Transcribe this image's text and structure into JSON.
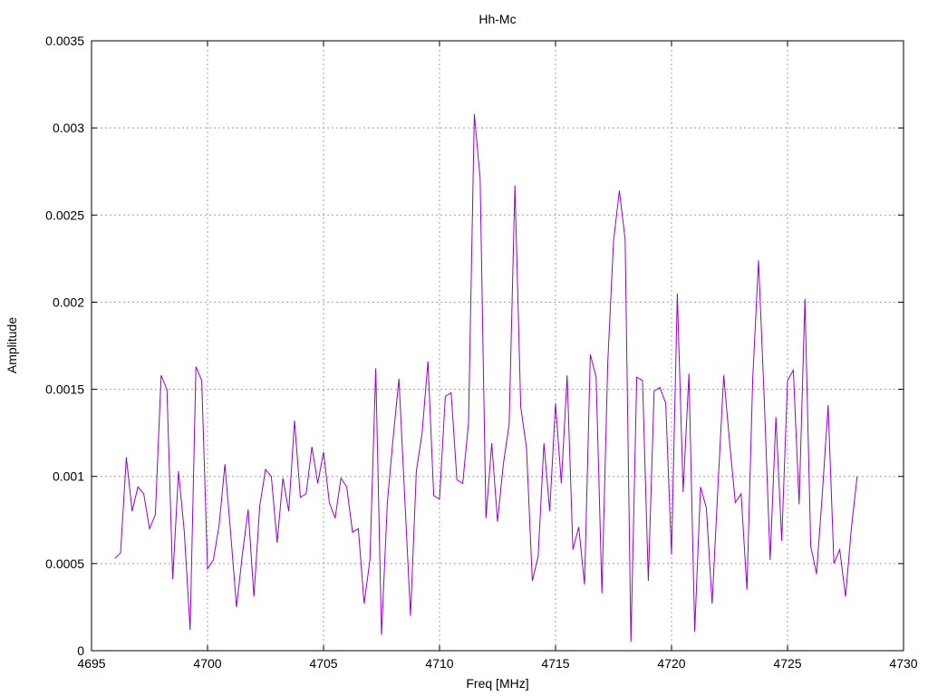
{
  "chart_data": {
    "type": "line",
    "title": "Hh-Mc",
    "xlabel": "Freq [MHz]",
    "ylabel": "Amplitude",
    "xlim": [
      4695,
      4730
    ],
    "ylim": [
      0,
      0.0035
    ],
    "xticks": [
      4695,
      4700,
      4705,
      4710,
      4715,
      4720,
      4725,
      4730
    ],
    "yticks": [
      0,
      0.0005,
      0.001,
      0.0015,
      0.002,
      0.0025,
      0.003,
      0.0035
    ],
    "xtick_labels": [
      "4695",
      "4700",
      "4705",
      "4710",
      "4715",
      "4720",
      "4725",
      "4730"
    ],
    "ytick_labels": [
      "0",
      "0.0005",
      "0.001",
      "0.0015",
      "0.002",
      "0.0025",
      "0.003",
      "0.0035"
    ],
    "grid": true,
    "legend": "none",
    "color": "#9400d3",
    "series": [
      {
        "x": [
          4696.0,
          4696.25,
          4696.5,
          4696.75,
          4697.0,
          4697.25,
          4697.5,
          4697.75,
          4698.0,
          4698.25,
          4698.5,
          4698.75,
          4699.0,
          4699.25,
          4699.5,
          4699.75,
          4700.0,
          4700.25,
          4700.5,
          4700.75,
          4701.0,
          4701.25,
          4701.5,
          4701.75,
          4702.0,
          4702.25,
          4702.5,
          4702.75,
          4703.0,
          4703.25,
          4703.5,
          4703.75,
          4704.0,
          4704.25,
          4704.5,
          4704.75,
          4705.0,
          4705.25,
          4705.5,
          4705.75,
          4706.0,
          4706.25,
          4706.5,
          4706.75,
          4707.0,
          4707.25,
          4707.5,
          4707.75,
          4708.0,
          4708.25,
          4708.5,
          4708.75,
          4709.0,
          4709.25,
          4709.5,
          4709.75,
          4710.0,
          4710.25,
          4710.5,
          4710.75,
          4711.0,
          4711.25,
          4711.5,
          4711.75,
          4712.0,
          4712.25,
          4712.5,
          4712.75,
          4713.0,
          4713.25,
          4713.5,
          4713.75,
          4714.0,
          4714.25,
          4714.5,
          4714.75,
          4715.0,
          4715.25,
          4715.5,
          4715.75,
          4716.0,
          4716.25,
          4716.5,
          4716.75,
          4717.0,
          4717.25,
          4717.5,
          4717.75,
          4718.0,
          4718.25,
          4718.5,
          4718.75,
          4719.0,
          4719.25,
          4719.5,
          4719.75,
          4720.0,
          4720.25,
          4720.5,
          4720.75,
          4721.0,
          4721.25,
          4721.5,
          4721.75,
          4722.0,
          4722.25,
          4722.5,
          4722.75,
          4723.0,
          4723.25,
          4723.5,
          4723.75,
          4724.0,
          4724.25,
          4724.5,
          4724.75,
          4725.0,
          4725.25,
          4725.5,
          4725.75,
          4726.0,
          4726.25,
          4726.5,
          4726.75,
          4727.0,
          4727.25,
          4727.5,
          4727.75,
          4728.0
        ],
        "values": [
          0.00053,
          0.00056,
          0.00111,
          0.0008,
          0.00094,
          0.0009,
          0.0007,
          0.00078,
          0.00158,
          0.0015,
          0.00041,
          0.00103,
          0.00068,
          0.00012,
          0.00163,
          0.00155,
          0.00047,
          0.00052,
          0.00072,
          0.00107,
          0.00067,
          0.00025,
          0.00055,
          0.00081,
          0.00031,
          0.00083,
          0.00104,
          0.001,
          0.00062,
          0.00099,
          0.0008,
          0.00132,
          0.00088,
          0.0009,
          0.00117,
          0.00096,
          0.00114,
          0.00085,
          0.00076,
          0.00099,
          0.00094,
          0.00068,
          0.0007,
          0.00027,
          0.00052,
          0.00162,
          9e-05,
          0.00085,
          0.00122,
          0.00156,
          0.00088,
          0.0002,
          0.00103,
          0.00125,
          0.00166,
          0.00089,
          0.00087,
          0.00146,
          0.00148,
          0.00098,
          0.00096,
          0.00131,
          0.00308,
          0.00271,
          0.00076,
          0.00119,
          0.00074,
          0.00107,
          0.0013,
          0.00267,
          0.0014,
          0.00116,
          0.0004,
          0.00054,
          0.00119,
          0.0008,
          0.00142,
          0.00096,
          0.00158,
          0.00058,
          0.00071,
          0.00038,
          0.0017,
          0.00157,
          0.00033,
          0.00165,
          0.00235,
          0.00264,
          0.00236,
          5e-05,
          0.00157,
          0.00155,
          0.0004,
          0.00149,
          0.00151,
          0.00142,
          0.00055,
          0.00205,
          0.00091,
          0.00159,
          0.00011,
          0.00094,
          0.00082,
          0.00027,
          0.00094,
          0.00158,
          0.0012,
          0.00085,
          0.0009,
          0.00035,
          0.00156,
          0.00224,
          0.00143,
          0.00052,
          0.00134,
          0.00063,
          0.00155,
          0.00161,
          0.00084,
          0.00202,
          0.0006,
          0.00044,
          0.0009,
          0.00141,
          0.0005,
          0.00058,
          0.00031,
          0.0007,
          0.001
        ]
      }
    ]
  }
}
